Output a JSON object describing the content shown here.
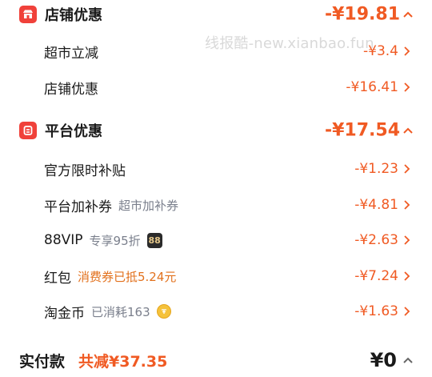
{
  "watermark": "线报酷-new.xianbao.fun",
  "shop_discount": {
    "title": "店铺优惠",
    "amount": "-¥19.81",
    "items": [
      {
        "label": "超市立减",
        "amount": "-¥3.4"
      },
      {
        "label": "店铺优惠",
        "amount": "-¥16.41"
      }
    ]
  },
  "platform_discount": {
    "title": "平台优惠",
    "amount": "-¥17.54",
    "items": [
      {
        "label": "官方限时补贴",
        "tag": "",
        "amount": "-¥1.23"
      },
      {
        "label": "平台加补券",
        "tag": "超市加补券",
        "amount": "-¥4.81"
      },
      {
        "label": "88VIP",
        "tag": "专享95折",
        "badge": "88",
        "amount": "-¥2.63"
      },
      {
        "label": "红包",
        "tag": "消费券已抵5.24元",
        "amount": "-¥7.24"
      },
      {
        "label": "淘金币",
        "tag": "已消耗163",
        "amount": "-¥1.63"
      }
    ]
  },
  "footer": {
    "label": "实付款",
    "reduce_text": "共减¥37.35",
    "total": "¥0"
  },
  "colors": {
    "accent": "#f05a23",
    "icon_red": "#f0413a"
  }
}
